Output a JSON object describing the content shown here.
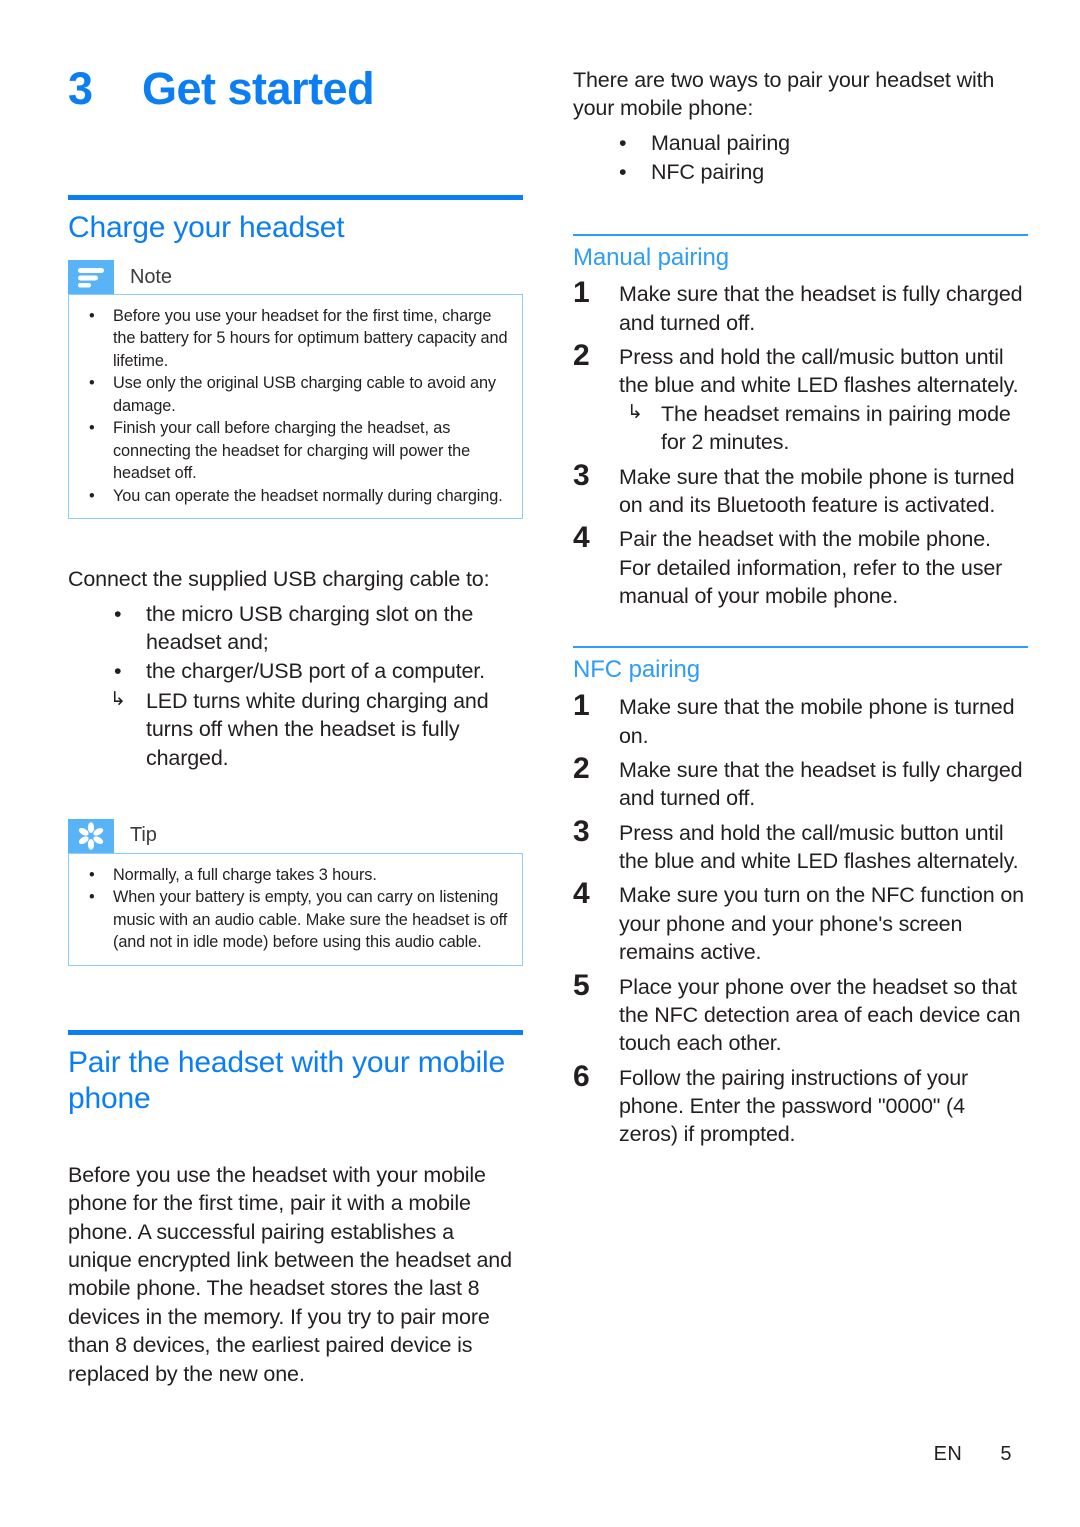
{
  "colors": {
    "accent": "#0b7ef4",
    "accent_light": "#2e9df7",
    "callout_icon_bg": "#59b4f7",
    "callout_border": "#8ecdf7",
    "text": "#231f20"
  },
  "chapter": {
    "number": "3",
    "title": "Get started"
  },
  "left_column": {
    "section_charge": {
      "heading": "Charge your headset",
      "note_callout": {
        "icon": "note-lines-icon",
        "label": "Note",
        "items": [
          "Before you use your headset for the first time, charge the battery for 5 hours for optimum battery capacity and lifetime.",
          "Use only the original USB charging cable to avoid any damage.",
          "Finish your call before charging the headset, as connecting the headset for charging will power the headset off.",
          "You can operate the headset normally during charging."
        ]
      },
      "intro": "Connect the supplied USB charging cable to:",
      "bullets": [
        {
          "marker": "•",
          "type": "bullet",
          "text": "the micro USB charging slot on the headset and;"
        },
        {
          "marker": "•",
          "type": "bullet",
          "text": "the charger/USB port of a computer."
        },
        {
          "marker": "↳",
          "type": "arrow",
          "text": "LED turns white during charging and turns off when the headset is fully charged."
        }
      ],
      "tip_callout": {
        "icon": "tip-asterisk-icon",
        "label": "Tip",
        "items": [
          "Normally, a full charge takes 3 hours.",
          "When your battery is empty, you can carry on listening music with an audio cable. Make sure the headset is off (and not in idle mode) before using this audio cable."
        ]
      }
    },
    "section_pair": {
      "heading": "Pair the headset with your mobile phone",
      "paragraph": "Before you use the headset with your mobile phone for the first time, pair it with a mobile phone. A successful pairing establishes a unique encrypted link between the headset and mobile phone. The headset stores the last 8 devices in the memory. If you try to pair more than 8 devices, the earliest paired device is replaced by the new one."
    }
  },
  "right_column": {
    "intro": "There are two ways to pair your headset with your mobile phone:",
    "intro_bullets": [
      {
        "marker": "•",
        "type": "bullet",
        "text": "Manual pairing"
      },
      {
        "marker": "•",
        "type": "bullet",
        "text": "NFC pairing"
      }
    ],
    "manual_pairing": {
      "heading": "Manual pairing",
      "steps": [
        {
          "num": "1",
          "text": "Make sure that the headset is fully charged and turned off.",
          "sub": []
        },
        {
          "num": "2",
          "text": "Press and hold the call/music button until the blue and white LED flashes alternately.",
          "sub": [
            {
              "marker": "↳",
              "text": "The headset remains in pairing mode for 2 minutes."
            }
          ]
        },
        {
          "num": "3",
          "text": "Make sure that the mobile phone is turned on and its Bluetooth feature is activated.",
          "sub": []
        },
        {
          "num": "4",
          "text": "Pair the headset with the mobile phone. For detailed information, refer to the user manual of your mobile phone.",
          "sub": []
        }
      ]
    },
    "nfc_pairing": {
      "heading": "NFC pairing",
      "steps": [
        {
          "num": "1",
          "text": "Make sure that the mobile phone is turned on.",
          "sub": []
        },
        {
          "num": "2",
          "text": "Make sure that the headset is fully charged and turned off.",
          "sub": []
        },
        {
          "num": "3",
          "text": "Press and hold the call/music button until the blue and white LED flashes alternately.",
          "sub": []
        },
        {
          "num": "4",
          "text": "Make sure you turn on the NFC function on your phone and your phone's screen remains active.",
          "sub": []
        },
        {
          "num": "5",
          "text": "Place your phone over the headset so that the NFC detection area of each device can touch each other.",
          "sub": []
        },
        {
          "num": "6",
          "text": "Follow the pairing instructions of your phone. Enter the password \"0000\" (4 zeros) if prompted.",
          "sub": []
        }
      ]
    }
  },
  "footer": {
    "language": "EN",
    "page_number": "5"
  }
}
